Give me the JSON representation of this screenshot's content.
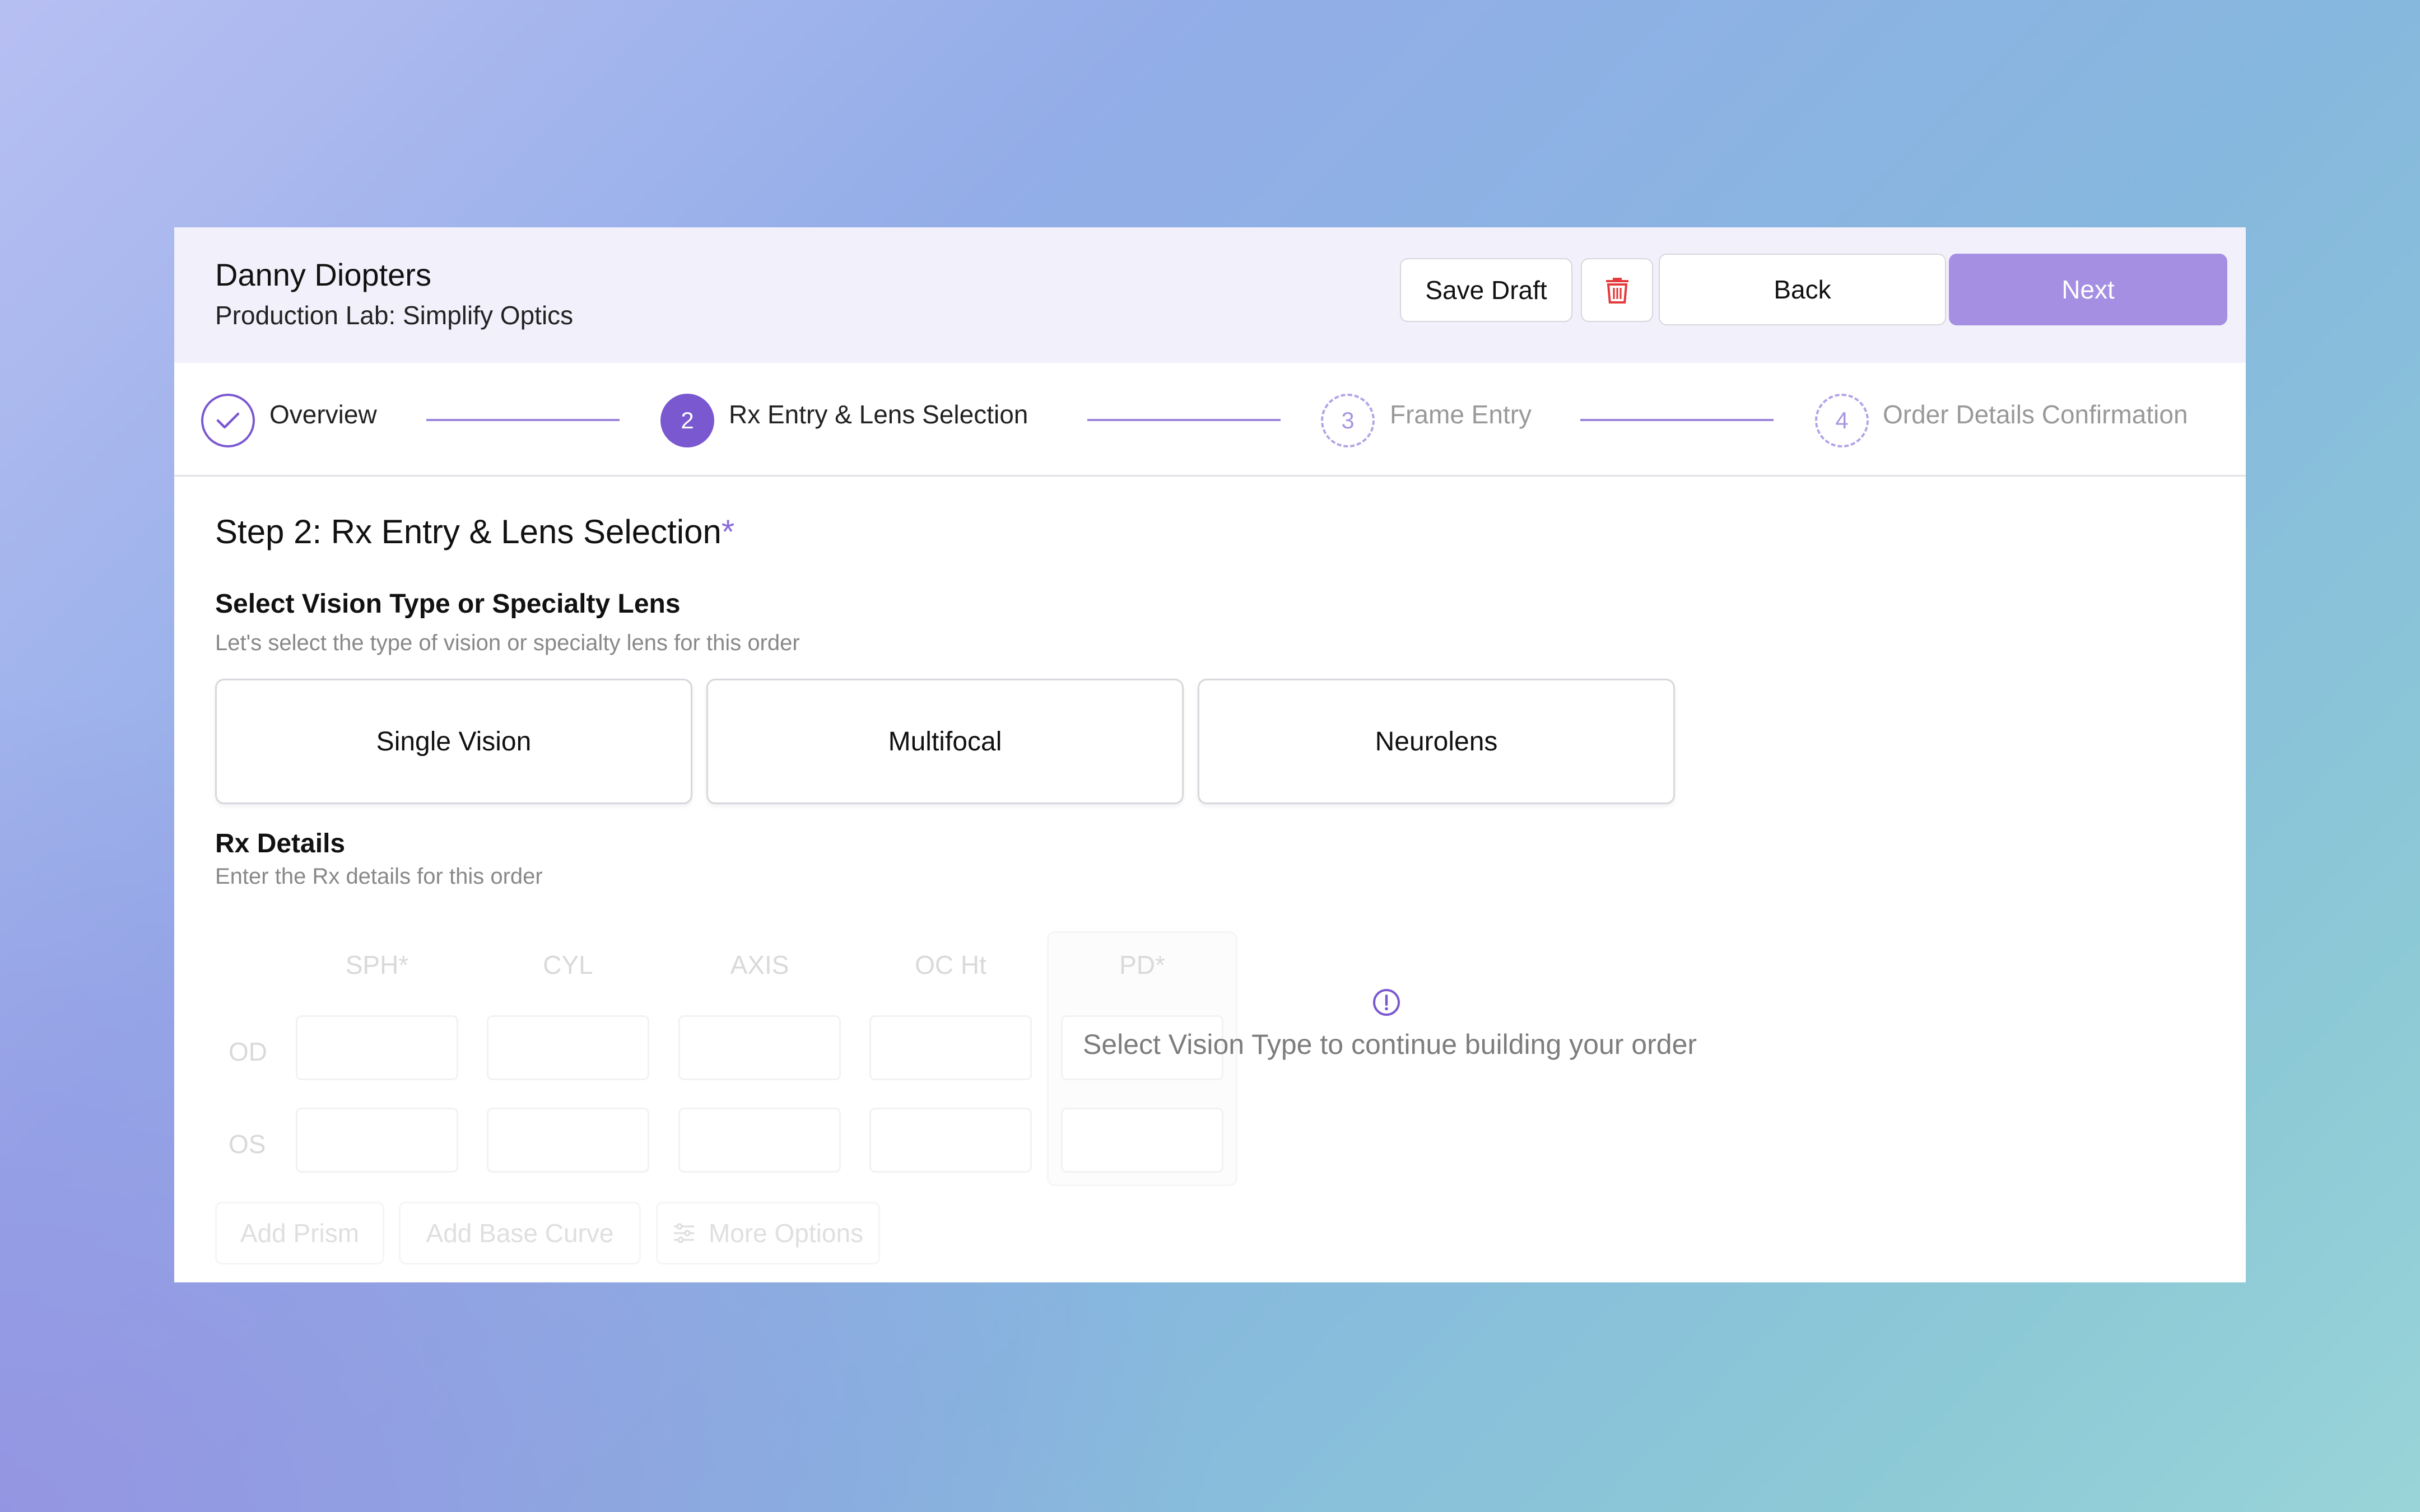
{
  "header": {
    "patient_name": "Danny Diopters",
    "lab": "Production Lab: Simplify Optics",
    "save_draft_label": "Save Draft",
    "back_label": "Back",
    "next_label": "Next",
    "trash_icon": "trash-icon"
  },
  "stepper": {
    "steps": [
      {
        "number": "",
        "label": "Overview",
        "state": "completed"
      },
      {
        "number": "2",
        "label": "Rx Entry & Lens Selection",
        "state": "active"
      },
      {
        "number": "3",
        "label": "Frame Entry",
        "state": "upcoming"
      },
      {
        "number": "4",
        "label": "Order Details Confirmation",
        "state": "upcoming"
      }
    ]
  },
  "main": {
    "step_title": "Step 2: Rx Entry & Lens Selection",
    "required_marker": "*",
    "vision_section": {
      "title": "Select Vision Type or Specialty Lens",
      "subtitle": "Let's select the type of vision or specialty lens for this order",
      "options": [
        "Single Vision",
        "Multifocal",
        "Neurolens"
      ]
    },
    "rx_section": {
      "title": "Rx Details",
      "subtitle": "Enter the Rx details for this order",
      "columns": [
        "SPH*",
        "CYL",
        "AXIS",
        "OC Ht",
        "PD*"
      ],
      "rows": [
        "OD",
        "OS"
      ],
      "buttons": {
        "add_prism": "Add Prism",
        "add_base_curve": "Add Base Curve",
        "more_options": "More Options"
      }
    },
    "overlay_message": "Select Vision Type to continue building your order"
  },
  "colors": {
    "accent": "#7a58d0",
    "next_button": "#a48fe3",
    "header_bg": "#f2f1fb"
  }
}
